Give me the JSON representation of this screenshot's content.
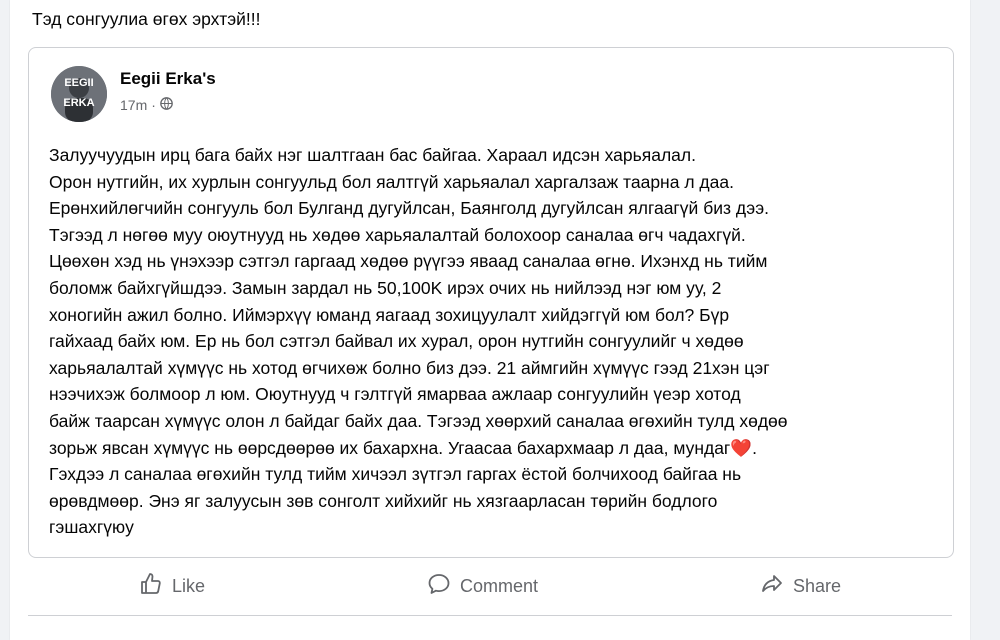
{
  "share": {
    "text": "Тэд сонгуулиа өгөх эрхтэй!!!"
  },
  "post": {
    "avatar_text": "EEGII ERKA",
    "author": "Eegii Erka's",
    "time": "17m",
    "privacy_icon": "globe-icon",
    "body": "Залуучуудын ирц бага байх нэг шалтгаан бас байгаа. Хараал идсэн харьяалал.\nОрон нутгийн, их хурлын сонгуульд бол яалтгүй харьяалал харгалзаж таарна л даа.\nЕрөнхийлөгчийн сонгууль бол Булганд дугуйлсан, Баянголд дугуйлсан ялгаагүй биз дээ.\nТэгээд л нөгөө муу оюутнууд нь хөдөө харьяалалтай болохоор саналаа өгч чадахгүй.\nЦөөхөн хэд нь үнэхээр сэтгэл гаргаад хөдөө рүүгээ яваад саналаа өгнө. Ихэнхд нь тийм\nболомж байхгүйшдээ. Замын зардал нь 50,100K ирэх очих нь нийлээд нэг юм уу, 2\nхоногийн ажил болно. Иймэрхүү юманд яагаад зохицуулалт хийдэггүй юм бол? Бүр\nгайхаад байх юм. Ер нь бол сэтгэл байвал их хурал, орон нутгийн сонгуулийг ч хөдөө\nхарьяалалтай хүмүүс нь хотод өгчихөж болно биз дээ. 21 аймгийн хүмүүс гээд 21хэн цэг\nнээчихэж болмоор л юм. Оюутнууд ч гэлтгүй ямарваа ажлаар сонгуулийн үеэр хотод\nбайж таарсан хүмүүс олон л байдаг байх даа. Тэгээд хөөрхий саналаа өгөхийн тулд хөдөө\nзорьж явсан хүмүүс нь өөрсдөөрөө их бахархна. Угаасаа бахархмаар л даа, мундаг",
    "body_end_emoji": "❤️",
    "body_tail": ".\nГэхдээ л саналаа өгөхийн тулд тийм хичээл зүтгэл гаргах ёстой болчихоод байгаа нь\nөрөвдмөөр. Энэ яг залуусын зөв сонголт хийхийг нь хязгаарласан төрийн бодлого\nгэшахгүюу"
  },
  "actions": {
    "like": "Like",
    "comment": "Comment",
    "share": "Share"
  },
  "colors": {
    "secondary_text": "#65676b",
    "heart": "#e41e3f",
    "border": "#ced0d4"
  }
}
